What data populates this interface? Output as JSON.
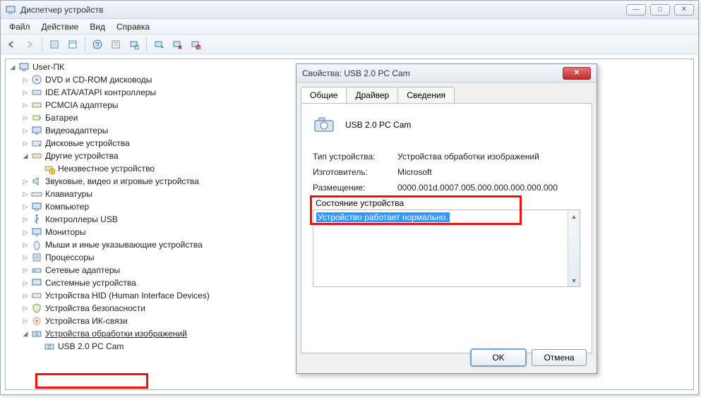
{
  "window": {
    "title": "Диспетчер устройств"
  },
  "menu": {
    "file": "Файл",
    "action": "Действие",
    "view": "Вид",
    "help": "Справка"
  },
  "tree": {
    "root": "User-ПК",
    "items": [
      "DVD и CD-ROM дисководы",
      "IDE ATA/ATAPI контроллеры",
      "PCMCIA адаптеры",
      "Батареи",
      "Видеоадаптеры",
      "Дисковые устройства",
      "Другие устройства",
      "Звуковые, видео и игровые устройства",
      "Клавиатуры",
      "Компьютер",
      "Контроллеры USB",
      "Мониторы",
      "Мыши и иные указывающие устройства",
      "Процессоры",
      "Сетевые адаптеры",
      "Системные устройства",
      "Устройства HID (Human Interface Devices)",
      "Устройства безопасности",
      "Устройства ИК-связи",
      "Устройства обработки изображений"
    ],
    "unknown_device": "Неизвестное устройство",
    "camera": "USB 2.0 PC Cam"
  },
  "dialog": {
    "title": "Свойства: USB 2.0 PC Cam",
    "tabs": {
      "general": "Общие",
      "driver": "Драйвер",
      "details": "Сведения"
    },
    "device_name": "USB 2.0 PC Cam",
    "type_label": "Тип устройства:",
    "type_value": "Устройства обработки изображений",
    "manufacturer_label": "Изготовитель:",
    "manufacturer_value": "Microsoft",
    "location_label": "Размещение:",
    "location_value": "0000.001d.0007.005.000.000.000.000.000",
    "status_label": "Состояние устройства",
    "status_text": "Устройство работает нормально.",
    "ok": "OK",
    "cancel": "Отмена"
  }
}
